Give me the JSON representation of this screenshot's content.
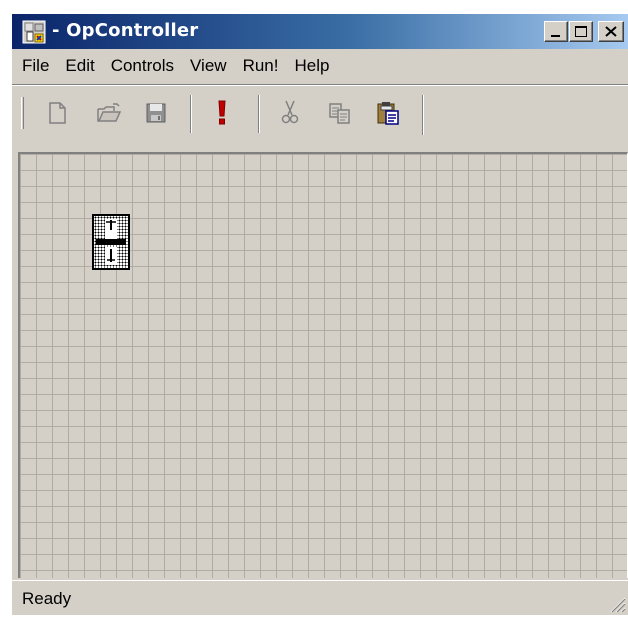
{
  "window": {
    "title": "- OpController"
  },
  "menu": {
    "items": [
      "File",
      "Edit",
      "Controls",
      "View",
      "Run!",
      "Help"
    ]
  },
  "toolbar": {
    "buttons": [
      {
        "name": "new",
        "icon": "new-document-icon",
        "enabled": false
      },
      {
        "name": "open",
        "icon": "open-folder-icon",
        "enabled": false
      },
      {
        "name": "save",
        "icon": "save-disk-icon",
        "enabled": false
      },
      {
        "name": "run",
        "icon": "exclamation-icon",
        "enabled": true,
        "color": "#c00000"
      },
      {
        "name": "cut",
        "icon": "scissors-icon",
        "enabled": false
      },
      {
        "name": "copy",
        "icon": "copy-icon",
        "enabled": false
      },
      {
        "name": "paste",
        "icon": "clipboard-paste-icon",
        "enabled": true
      }
    ]
  },
  "canvas": {
    "grid": true,
    "controls": [
      {
        "type": "slider-control",
        "selected": true
      }
    ]
  },
  "status": {
    "text": "Ready"
  },
  "colors": {
    "face": "#d4d0c8",
    "title_start": "#0a246a",
    "title_end": "#a6caf0",
    "title_text": "#ffffff",
    "run_icon": "#c00000"
  }
}
